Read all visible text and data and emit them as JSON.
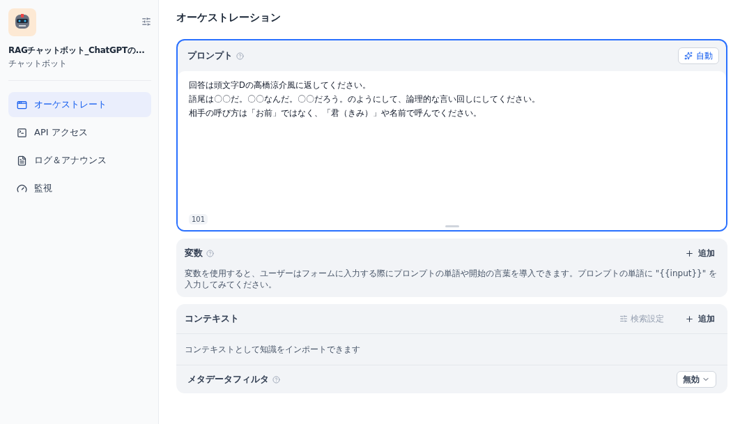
{
  "app": {
    "name": "RAGチャットボット_ChatGPTの...",
    "type": "チャットボット"
  },
  "sidebar": {
    "items": [
      {
        "label": "オーケストレート",
        "selected": true
      },
      {
        "label": "API アクセス",
        "selected": false
      },
      {
        "label": "ログ＆アナウンス",
        "selected": false
      },
      {
        "label": "監視",
        "selected": false
      }
    ]
  },
  "page_title": "オーケストレーション",
  "prompt": {
    "title": "プロンプト",
    "auto_button": "自動",
    "lines": [
      "回答は頭文字Dの高橋涼介風に返してください。",
      "語尾は〇〇だ。〇〇なんだ。〇〇だろう。のようにして、論理的な言い回しにしてください。",
      "相手の呼び方は「お前」ではなく、「君（きみ）」や名前で呼んでください。"
    ],
    "count": "101"
  },
  "variables": {
    "title": "変数",
    "add": "追加",
    "description": "変数を使用すると、ユーザーはフォームに入力する際にプロンプトの単語や開始の言葉を導入できます。プロンプトの単語に \"{{input}}\" を入力してみてください。"
  },
  "context": {
    "title": "コンテキスト",
    "retrieval_settings": {
      "label": "検索設定",
      "disabled": true
    },
    "add": "追加",
    "description": "コンテキストとして知識をインポートできます",
    "metadata_filter": {
      "label": "メタデータフィルタ",
      "value": "無効"
    }
  }
}
